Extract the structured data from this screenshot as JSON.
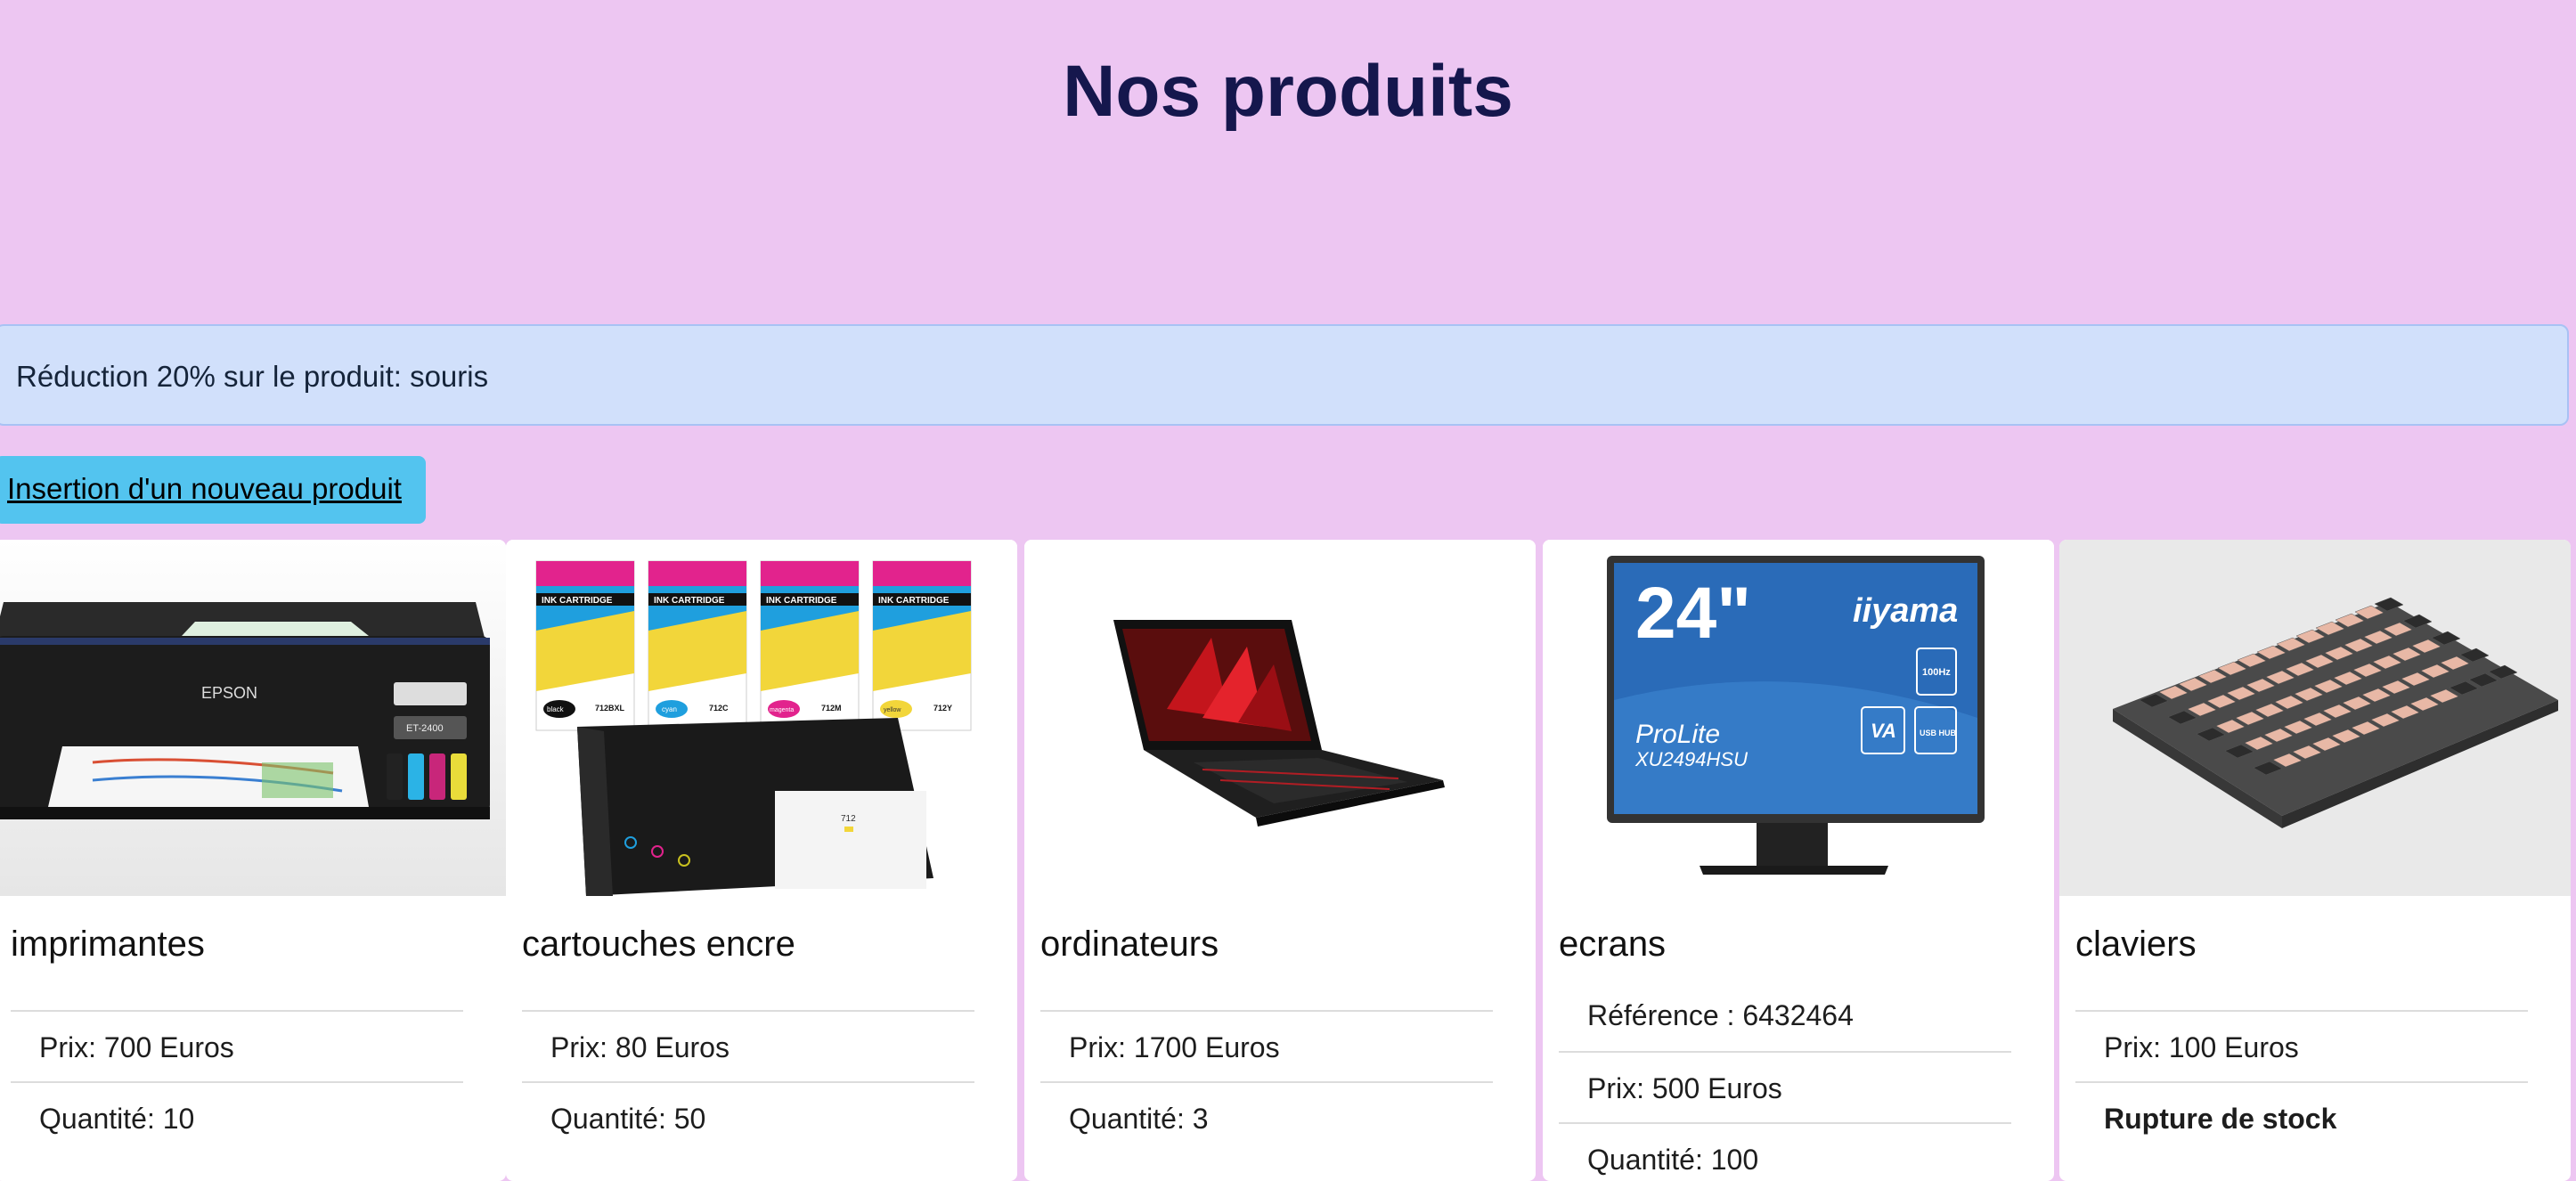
{
  "page": {
    "title": "Nos produits"
  },
  "alert": {
    "text": "Réduction 20% sur le produit: souris"
  },
  "insert_link": {
    "label": "Insertion d'un nouveau produit"
  },
  "products": [
    {
      "name": "imprimantes",
      "lines": [
        "Prix: 700 Euros",
        "Quantité: 10"
      ]
    },
    {
      "name": "cartouches encre",
      "lines": [
        "Prix: 80 Euros",
        "Quantité: 50"
      ]
    },
    {
      "name": "ordinateurs",
      "lines": [
        "Prix: 1700 Euros",
        "Quantité: 3"
      ]
    },
    {
      "name": "ecrans",
      "lines": [
        "Référence : 6432464",
        "Prix: 500 Euros",
        "Quantité: 100"
      ]
    },
    {
      "name": "claviers",
      "lines": [
        "Prix: 100 Euros",
        "Rupture de stock"
      ]
    }
  ],
  "image_text": {
    "printer_brand": "EPSON",
    "printer_model": "ET-2400",
    "cartridge_label": "INK CARTRIDGE",
    "cartridge_codes": [
      "712BXL",
      "712C",
      "712M",
      "712Y"
    ],
    "cartridge_colors": [
      "black",
      "cyan",
      "magenta",
      "yellow"
    ],
    "cartridge_box_code": "712",
    "monitor_size": "24\"",
    "monitor_brand": "iiyama",
    "monitor_line": "ProLite",
    "monitor_model": "XU2494HSU",
    "monitor_badges": [
      "100Hz",
      "VA",
      "USB HUB"
    ]
  },
  "colors": {
    "background": "#edc6f2",
    "title": "#15174d",
    "alert_bg": "#d1e0fb",
    "button_bg": "#53c4ef"
  }
}
